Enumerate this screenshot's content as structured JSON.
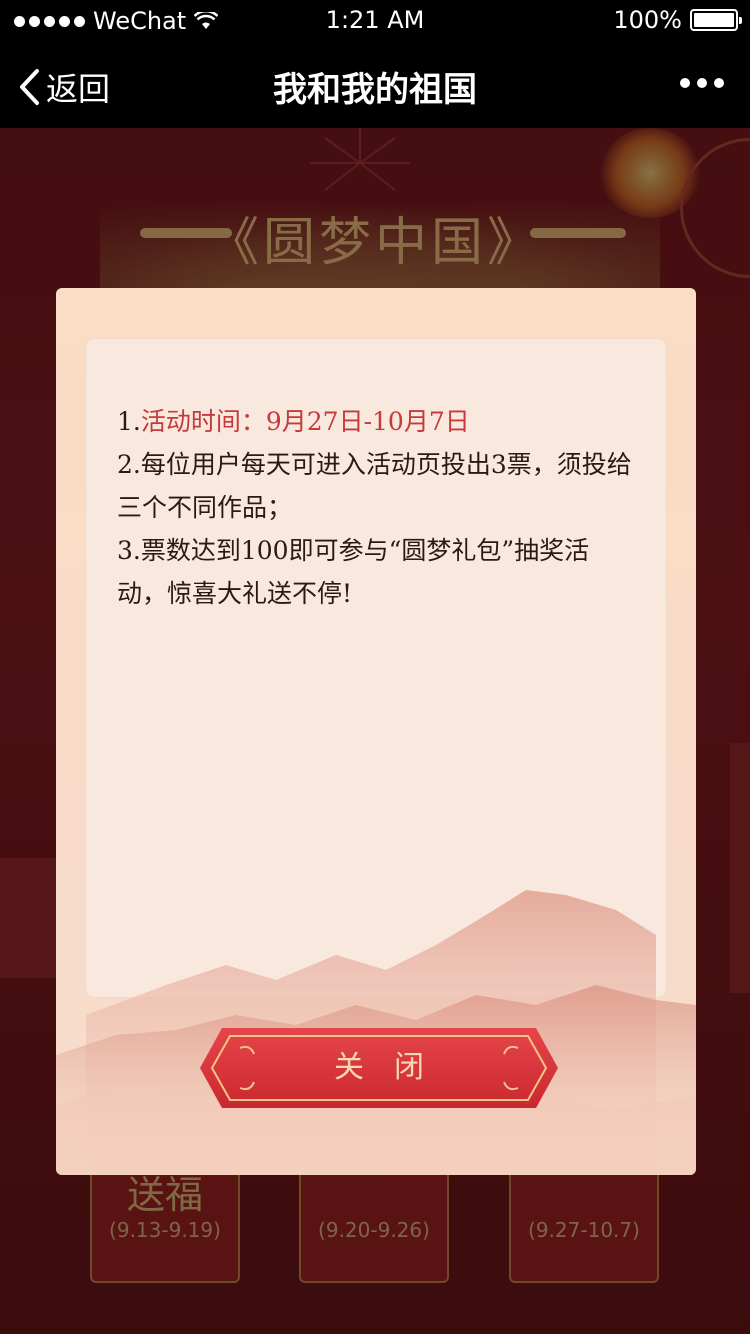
{
  "status_bar": {
    "carrier": "WeChat",
    "time": "1:21 AM",
    "battery": "100%"
  },
  "nav": {
    "back_label": "返回",
    "title": "我和我的祖国"
  },
  "background": {
    "banner_title": "《圆梦中国》",
    "cards": [
      {
        "title": "送福",
        "date": "(9.13-9.19)"
      },
      {
        "title": "",
        "date": "(9.20-9.26)"
      },
      {
        "title": "",
        "date": "(9.27-10.7)"
      }
    ]
  },
  "modal": {
    "rule1_prefix": "1.",
    "rule1_text": "活动时间：9月27日-10月7日",
    "rule2": "2.每位用户每天可进入活动页投出3票，须投给三个不同作品；",
    "rule3": "3.票数达到100即可参与“圆梦礼包”抽奖活动，惊喜大礼送不停!",
    "close_label": "关闭"
  },
  "colors": {
    "accent_red": "#c83a3a",
    "button_red": "#d6333d",
    "gold": "#f3c07f"
  }
}
